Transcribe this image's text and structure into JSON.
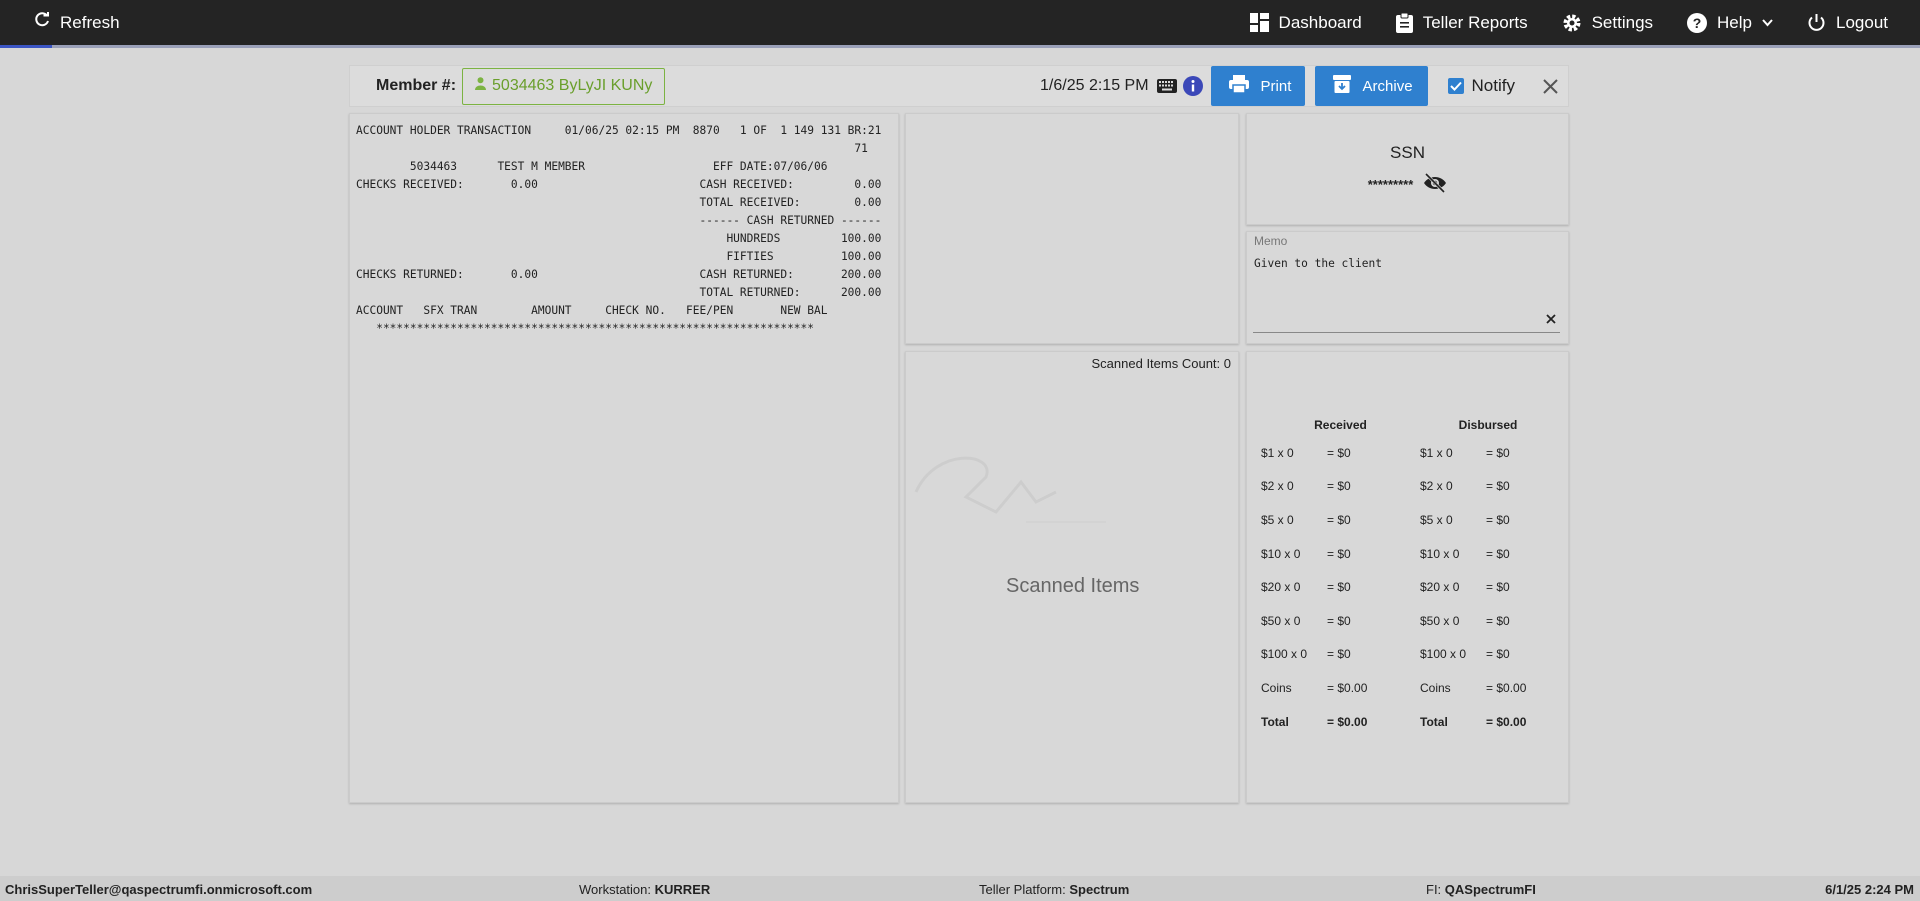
{
  "topbar": {
    "refresh_label": "Refresh",
    "progress_fraction": 0.027,
    "nav": [
      {
        "label": "Dashboard",
        "icon": "dashboard-icon"
      },
      {
        "label": "Teller Reports",
        "icon": "clipboard-icon"
      },
      {
        "label": "Settings",
        "icon": "gear-icon"
      },
      {
        "label": "Help",
        "icon": "help-icon"
      },
      {
        "label": "Logout",
        "icon": "power-icon"
      }
    ]
  },
  "header": {
    "member_label": "Member #:",
    "member_value": "5034463 ByLyJI KUNy",
    "datetime": "1/6/25 2:15 PM",
    "print_label": "Print",
    "archive_label": "Archive",
    "notify_label": "Notify",
    "notify_checked": true
  },
  "receipt": {
    "lines": [
      "ACCOUNT HOLDER TRANSACTION     01/06/25 02:15 PM  8870   1 OF  1 149 131 BR:21",
      "                                                                          71",
      "        5034463      TEST M MEMBER                   EFF DATE:07/06/06",
      "CHECKS RECEIVED:       0.00                        CASH RECEIVED:         0.00",
      "                                                   TOTAL RECEIVED:        0.00",
      "                                                   ------ CASH RETURNED ------",
      "                                                       HUNDREDS         100.00",
      "                                                       FIFTIES          100.00",
      "CHECKS RETURNED:       0.00                        CASH RETURNED:       200.00",
      "                                                   TOTAL RETURNED:      200.00",
      "ACCOUNT   SFX TRAN        AMOUNT     CHECK NO.   FEE/PEN       NEW BAL",
      "   *****************************************************************"
    ]
  },
  "scanned": {
    "count_label": "Scanned Items Count: 0",
    "title": "Scanned Items"
  },
  "ssn": {
    "title": "SSN",
    "masked": "*********"
  },
  "memo": {
    "label": "Memo",
    "text": "Given to the client"
  },
  "cash": {
    "received_header": "Received",
    "disbursed_header": "Disbursed",
    "rows": [
      {
        "rl": "$1 x 0",
        "rv": "= $0",
        "dl": "$1 x 0",
        "dv": "= $0"
      },
      {
        "rl": "$2 x 0",
        "rv": "= $0",
        "dl": "$2 x 0",
        "dv": "= $0"
      },
      {
        "rl": "$5 x 0",
        "rv": "= $0",
        "dl": "$5 x 0",
        "dv": "= $0"
      },
      {
        "rl": "$10 x 0",
        "rv": "= $0",
        "dl": "$10 x 0",
        "dv": "= $0"
      },
      {
        "rl": "$20 x 0",
        "rv": "= $0",
        "dl": "$20 x 0",
        "dv": "= $0"
      },
      {
        "rl": "$50 x 0",
        "rv": "= $0",
        "dl": "$50 x 0",
        "dv": "= $0"
      },
      {
        "rl": "$100 x 0",
        "rv": "= $0",
        "dl": "$100 x 0",
        "dv": "= $0"
      },
      {
        "rl": "Coins",
        "rv": "= $0.00",
        "dl": "Coins",
        "dv": "= $0.00"
      }
    ],
    "total": {
      "rl": "Total",
      "rv": "= $0.00",
      "dl": "Total",
      "dv": "= $0.00"
    }
  },
  "footer": {
    "user": "ChrisSuperTeller@qaspectrumfi.onmicrosoft.com",
    "workstation_label": "Workstation:",
    "workstation_value": "KURRER",
    "platform_label": "Teller Platform:",
    "platform_value": "Spectrum",
    "fi_label": "FI:",
    "fi_value": "QASpectrumFI",
    "datetime": "6/1/25 2:24 PM"
  }
}
